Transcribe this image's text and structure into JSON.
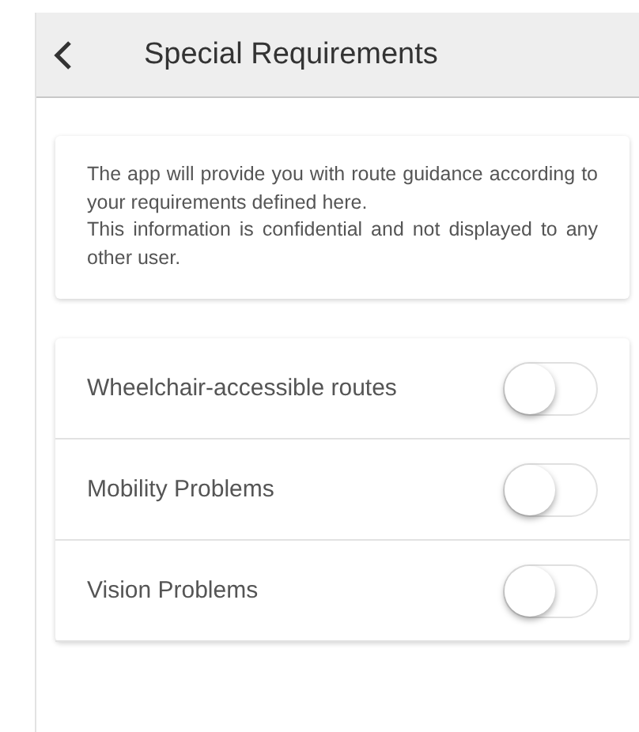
{
  "header": {
    "title": "Special Requirements"
  },
  "info": {
    "paragraphs": [
      "The app will provide you with route guidance according to your requirements defined here.",
      "This information is confidential and not displayed to any other user."
    ]
  },
  "requirements": [
    {
      "label": "Wheelchair-accessible routes",
      "on": false
    },
    {
      "label": "Mobility Problems",
      "on": false
    },
    {
      "label": "Vision Problems",
      "on": false
    }
  ]
}
